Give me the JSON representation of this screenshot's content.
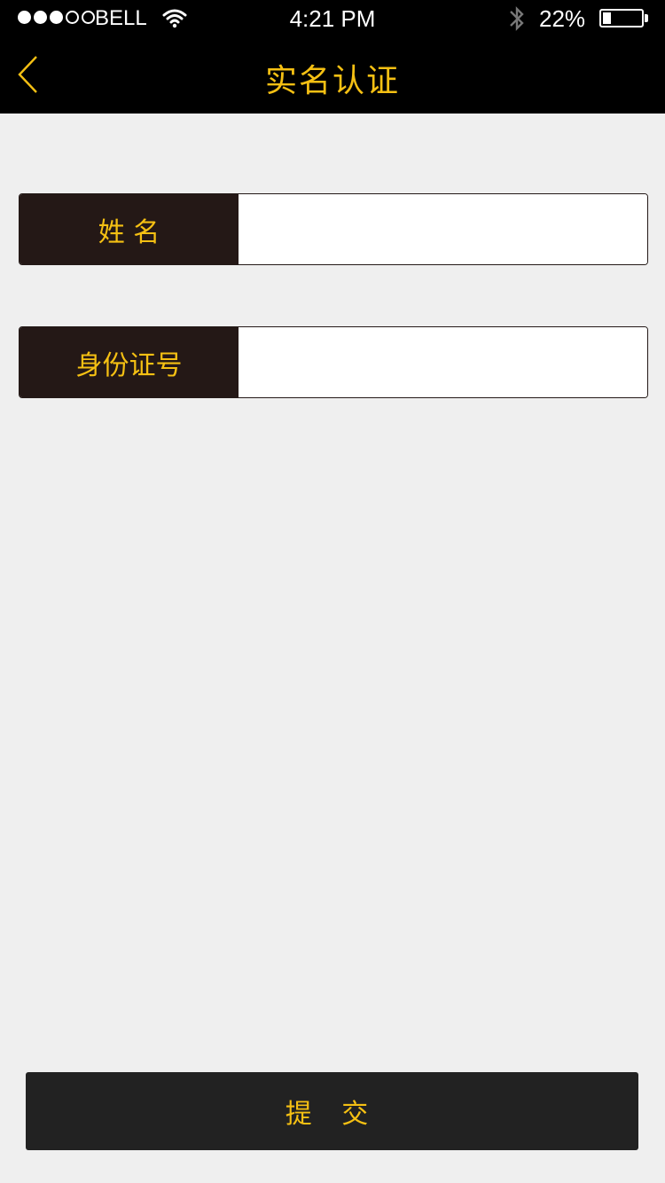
{
  "status_bar": {
    "carrier": "BELL",
    "time": "4:21 PM",
    "battery_percent": "22%",
    "battery_level": 0.22,
    "signal_bars_filled": 3,
    "signal_bars_total": 5
  },
  "nav": {
    "title": "实名认证",
    "accent_color": "#f5c013"
  },
  "form": {
    "name_label": "姓 名",
    "name_value": "",
    "id_label": "身份证号",
    "id_value": ""
  },
  "submit_label": "提 交"
}
